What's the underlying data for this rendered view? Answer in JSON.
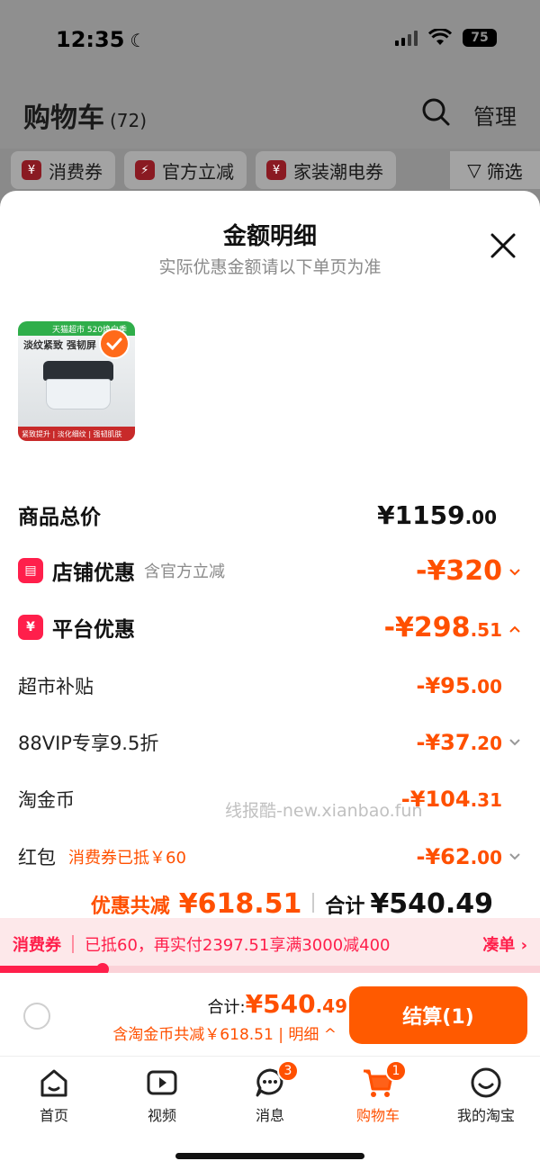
{
  "status_bar": {
    "time": "12:35",
    "battery": "75"
  },
  "header": {
    "title": "购物车",
    "count": "(72)",
    "manage": "管理"
  },
  "chips": [
    {
      "icon": "¥",
      "label": "消费券"
    },
    {
      "icon": "⚡",
      "label": "官方立减"
    },
    {
      "icon": "¥",
      "label": "家装潮电券"
    }
  ],
  "filter_label": "筛选",
  "sheet": {
    "title": "金额明细",
    "subtitle": "实际优惠金额请以下单页为准",
    "product_image": {
      "badge": "天猫超市 520焕白季",
      "slogan": "淡纹紧致 强韧屏",
      "footer": "紧致提升 | 淡化细纹 | 强韧肌肤"
    },
    "goods_total": {
      "label": "商品总价",
      "value": "¥1159",
      "decimals": ".00"
    },
    "store_discount": {
      "label": "店铺优惠",
      "note": "含官方立减",
      "value": "-¥320",
      "decimals": ""
    },
    "platform_discount": {
      "label": "平台优惠",
      "value": "-¥298",
      "decimals": ".51"
    },
    "items": [
      {
        "label": "超市补贴",
        "note": "",
        "value": "-¥95",
        "decimals": ".00",
        "chevron": false
      },
      {
        "label": "88VIP专享9.5折",
        "note": "",
        "value": "-¥37",
        "decimals": ".20",
        "chevron": true
      },
      {
        "label": "淘金币",
        "note": "",
        "value": "-¥104",
        "decimals": ".31",
        "chevron": false
      },
      {
        "label": "红包",
        "note": "消费券已抵￥60",
        "value": "-¥62",
        "decimals": ".00",
        "chevron": true
      }
    ],
    "summary": {
      "discount_label": "优惠共减",
      "discount_value": "¥618.51",
      "total_label": "合计",
      "total_value": "¥540.49"
    },
    "watermark": "线报酷-new.xianbao.fun"
  },
  "coupon_strip": {
    "label": "消费券",
    "text": "已抵60，再实付2397.51享满3000减400",
    "link": "凑单",
    "progress": 0.19
  },
  "checkout": {
    "sum_label": "合计:",
    "sum_value": "¥540",
    "sum_decimals": ".49",
    "detail": "含淘金币共减￥618.51 | 明细",
    "button": "结算(1)"
  },
  "tabs": [
    {
      "label": "首页",
      "icon": "home-icon",
      "badge": ""
    },
    {
      "label": "视频",
      "icon": "video-icon",
      "badge": ""
    },
    {
      "label": "消息",
      "icon": "message-icon",
      "badge": "3"
    },
    {
      "label": "购物车",
      "icon": "cart-icon",
      "badge": "1"
    },
    {
      "label": "我的淘宝",
      "icon": "profile-icon",
      "badge": ""
    }
  ],
  "colors": {
    "accent": "#ff5000",
    "coupon": "#ff1f4b",
    "checkout_button": "#ff5a00"
  }
}
